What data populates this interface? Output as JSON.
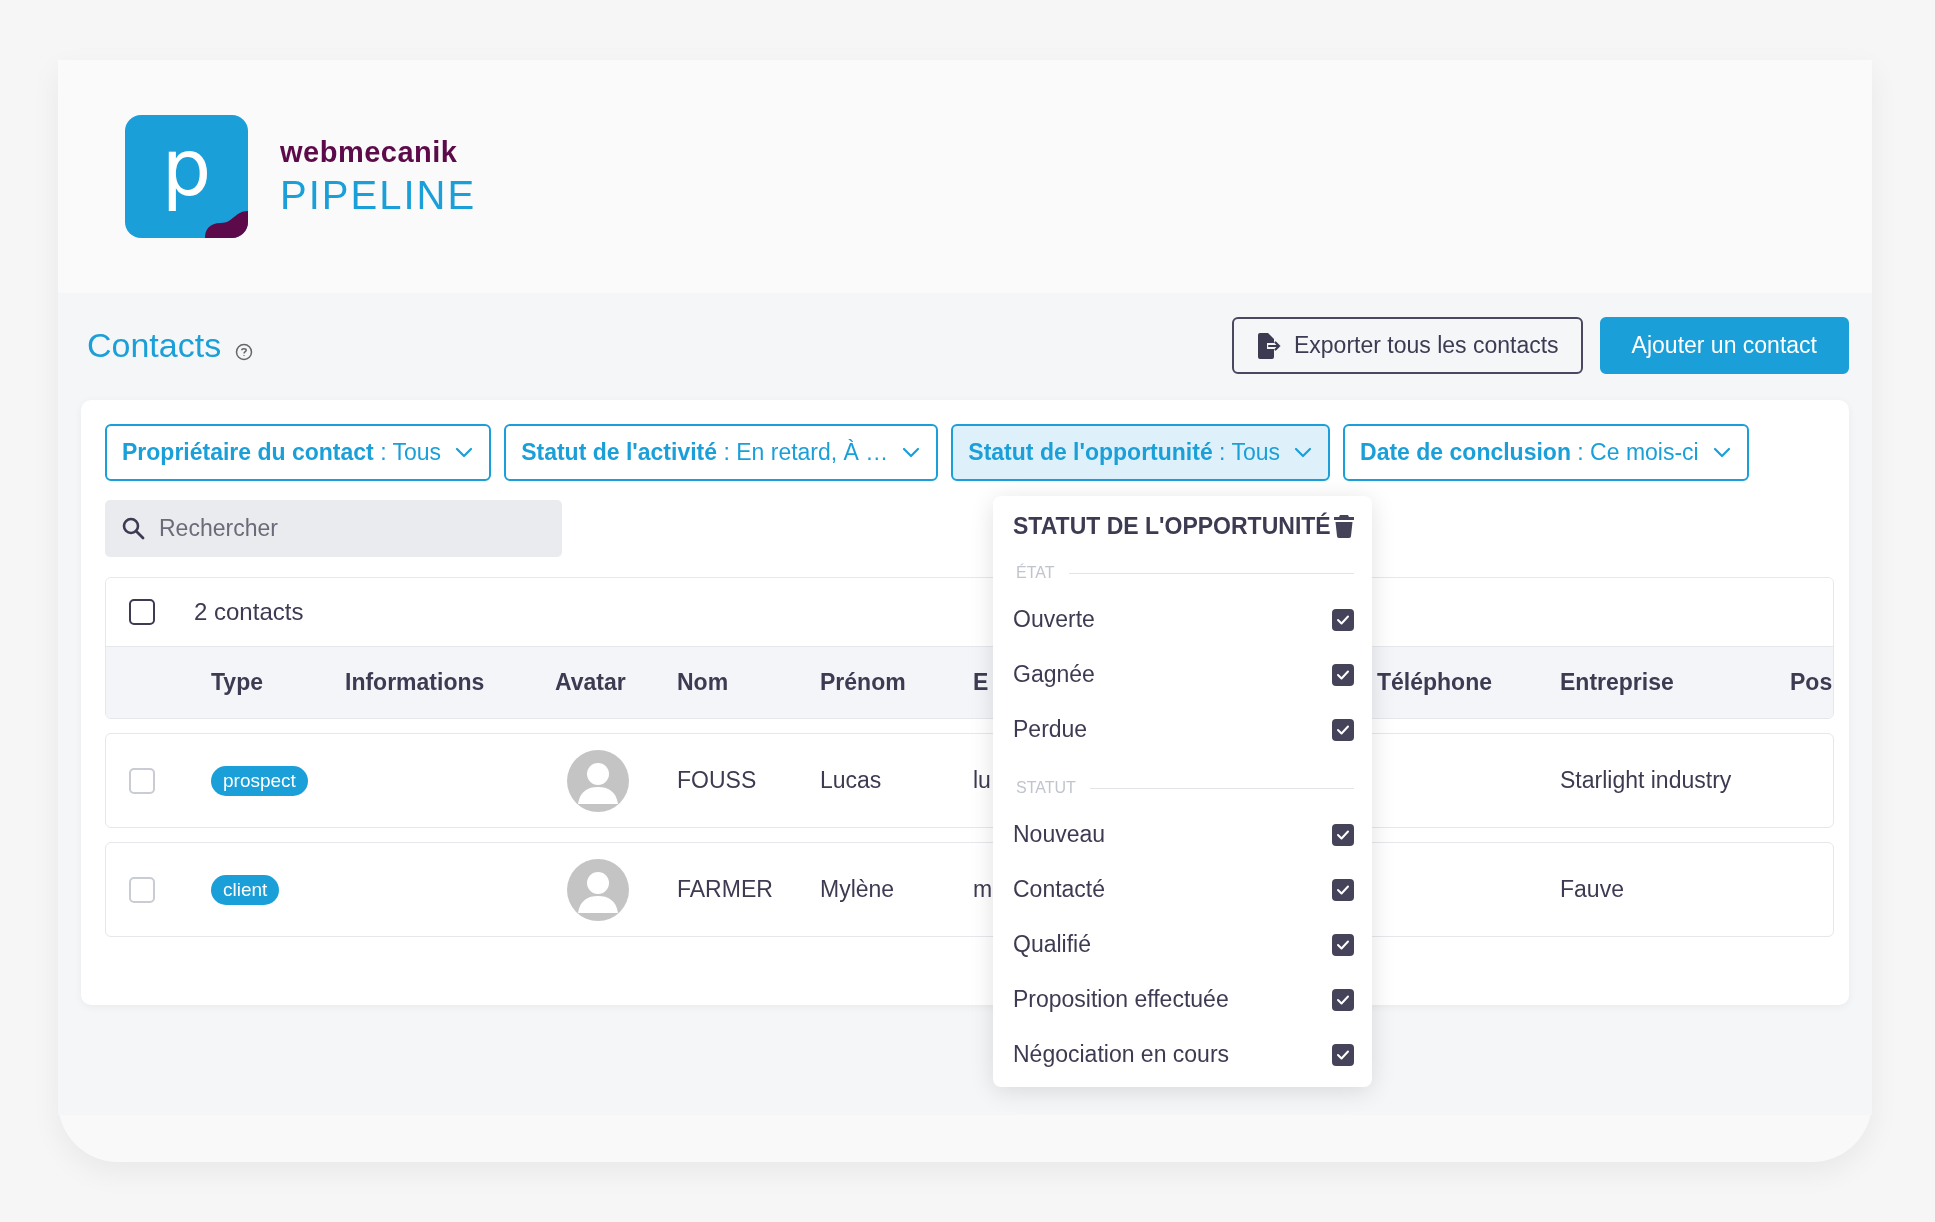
{
  "brand": {
    "logo_letter": "p",
    "company": "webmecanik",
    "product": "PIPELINE"
  },
  "page": {
    "title": "Contacts"
  },
  "actions": [
    {
      "kind": "outline",
      "label": "Exporter tous les contacts"
    },
    {
      "kind": "primary",
      "label": "Ajouter un contact"
    }
  ],
  "filters": [
    {
      "label": "Propriétaire du contact",
      "value": ": Tous",
      "selected": false
    },
    {
      "label": "Statut de l'activité",
      "value": ": En retard, À …",
      "selected": false
    },
    {
      "label": "Statut de l'opportunité",
      "value": ": Tous",
      "selected": true
    },
    {
      "label": "Date de conclusion",
      "value": ": Ce mois-ci",
      "selected": false
    }
  ],
  "search": {
    "placeholder": "Rechercher"
  },
  "table": {
    "select_all": {
      "checked": false
    },
    "count": "2 contacts",
    "columns": [
      "Type",
      "Informations",
      "Avatar",
      "Nom",
      "Prénom",
      "E",
      "Téléphone",
      "Entreprise",
      "Pos"
    ],
    "rows": [
      {
        "checked": false,
        "type": "prospect",
        "last_name": "FOUSS",
        "first_name": "Lucas",
        "email": "lu",
        "company": "Starlight industry"
      },
      {
        "checked": false,
        "type": "client",
        "last_name": "FARMER",
        "first_name": "Mylène",
        "email": "m",
        "company": "Fauve"
      }
    ]
  },
  "dropdown": {
    "title": "STATUT DE L'OPPORTUNITÉ",
    "groups": [
      {
        "label": "ÉTAT",
        "options": [
          {
            "label": "Ouverte",
            "checked": true
          },
          {
            "label": "Gagnée",
            "checked": true
          },
          {
            "label": "Perdue",
            "checked": true
          }
        ]
      },
      {
        "label": "STATUT",
        "options": [
          {
            "label": "Nouveau",
            "checked": true
          },
          {
            "label": "Contacté",
            "checked": true
          },
          {
            "label": "Qualifié",
            "checked": true
          },
          {
            "label": "Proposition effectuée",
            "checked": true
          },
          {
            "label": "Négociation en cours",
            "checked": true
          }
        ]
      }
    ]
  }
}
